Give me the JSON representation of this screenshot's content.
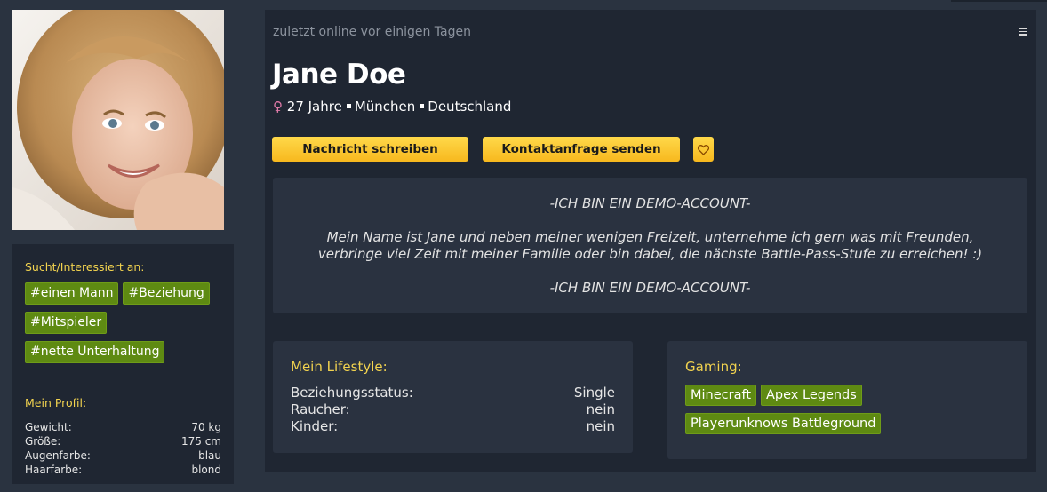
{
  "profile": {
    "online_status": "zuletzt online vor einigen Tagen",
    "name": "Jane Doe",
    "gender_symbol": "♀",
    "age": "27 Jahre",
    "city": "München",
    "country": "Deutschland"
  },
  "actions": {
    "message_label": "Nachricht schreiben",
    "contact_label": "Kontaktanfrage senden",
    "favorite_icon": "heart-icon",
    "menu_icon": "hamburger-menu-icon"
  },
  "about": {
    "line1": "-ICH BIN EIN DEMO-ACCOUNT-",
    "text": "Mein Name ist Jane und neben meiner wenigen Freizeit, unternehme ich gern was mit Freunden, verbringe viel Zeit mit meiner Familie oder bin dabei, die nächste Battle-Pass-Stufe zu erreichen! :)",
    "line3": "-ICH BIN EIN DEMO-ACCOUNT-"
  },
  "sidebar": {
    "search_title": "Sucht/Interessiert an:",
    "search_tags": [
      "#einen Mann",
      "#Beziehung",
      "#Mitspieler",
      "#nette Unterhaltung"
    ],
    "profile_title": "Mein Profil:",
    "profile_rows": [
      {
        "label": "Gewicht:",
        "value": "70 kg"
      },
      {
        "label": "Größe:",
        "value": "175 cm"
      },
      {
        "label": "Augenfarbe:",
        "value": "blau"
      },
      {
        "label": "Haarfarbe:",
        "value": "blond"
      }
    ]
  },
  "lifestyle": {
    "title": "Mein Lifestyle:",
    "rows": [
      {
        "label": "Beziehungsstatus:",
        "value": "Single"
      },
      {
        "label": "Raucher:",
        "value": "nein"
      },
      {
        "label": "Kinder:",
        "value": "nein"
      }
    ]
  },
  "gaming": {
    "title": "Gaming:",
    "games": [
      "Minecraft",
      "Apex Legends",
      "Playerunknows Battleground"
    ]
  },
  "colors": {
    "background": "#2a3340",
    "panel": "#1f2632",
    "accent_yellow": "#f2d34f",
    "tag_green": "#5e8a12",
    "button_yellow": "#f7b81e"
  }
}
